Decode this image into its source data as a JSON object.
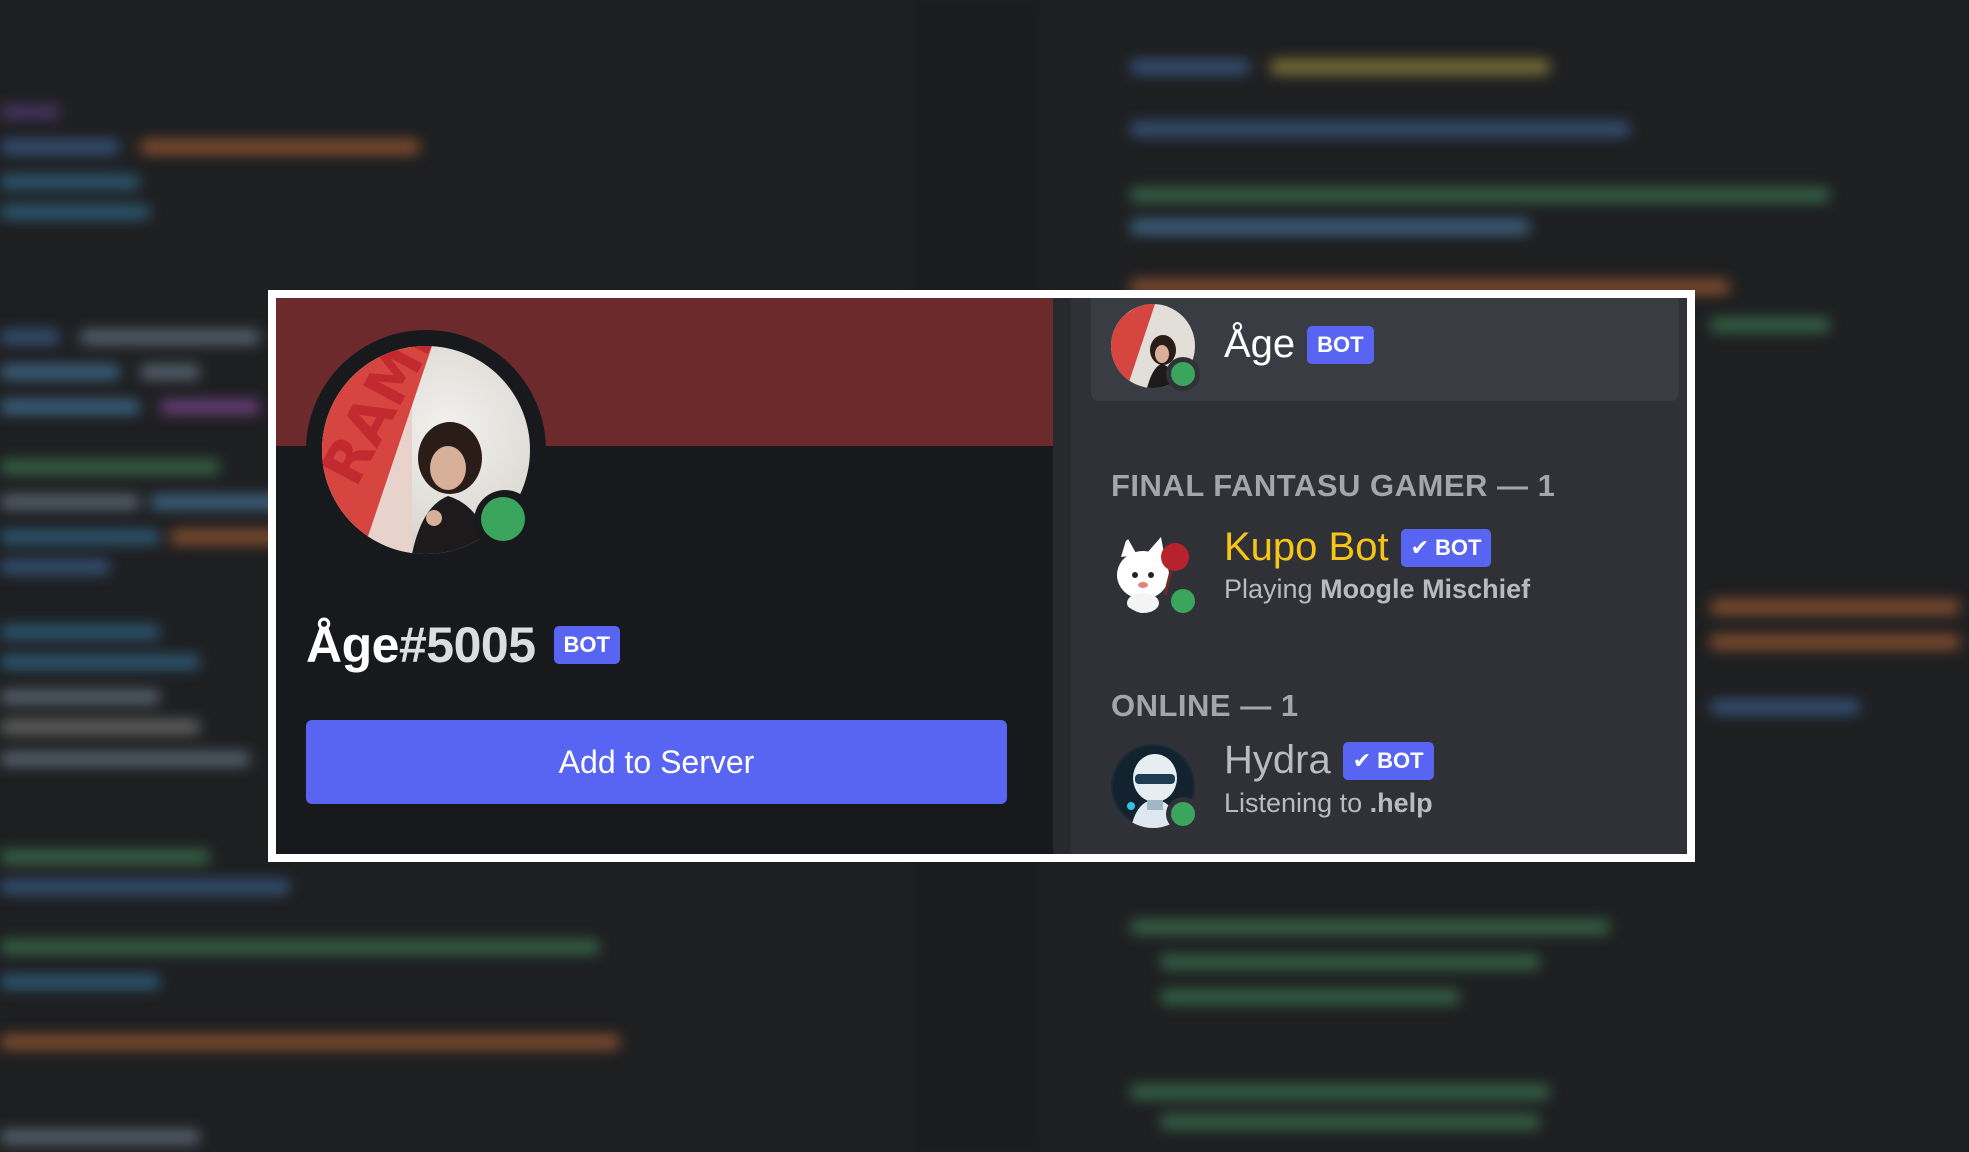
{
  "profile": {
    "name": "Åge",
    "discriminator": "#5005",
    "badge": "BOT",
    "banner_color": "#6c2a2d",
    "status": "online",
    "add_button_label": "Add to Server"
  },
  "member_list": {
    "highlighted_member": {
      "name": "Åge",
      "badge": "BOT",
      "status": "online"
    },
    "groups": [
      {
        "title": "FINAL FANTASU GAMER — 1",
        "members": [
          {
            "name": "Kupo Bot",
            "name_color": "#f5c518",
            "badge": "BOT",
            "verified": true,
            "activity_prefix": "Playing",
            "activity_value": "Moogle Mischief",
            "status": "online"
          }
        ]
      },
      {
        "title": "ONLINE — 1",
        "members": [
          {
            "name": "Hydra",
            "name_color": "#b9bbbe",
            "badge": "BOT",
            "verified": true,
            "activity_prefix": "Listening to",
            "activity_value": ".help",
            "status": "online"
          }
        ]
      }
    ]
  },
  "colors": {
    "blurple": "#5865f2",
    "online": "#3ba55d",
    "frame": "#ffffff"
  },
  "icons": {
    "verified": "check-icon"
  }
}
